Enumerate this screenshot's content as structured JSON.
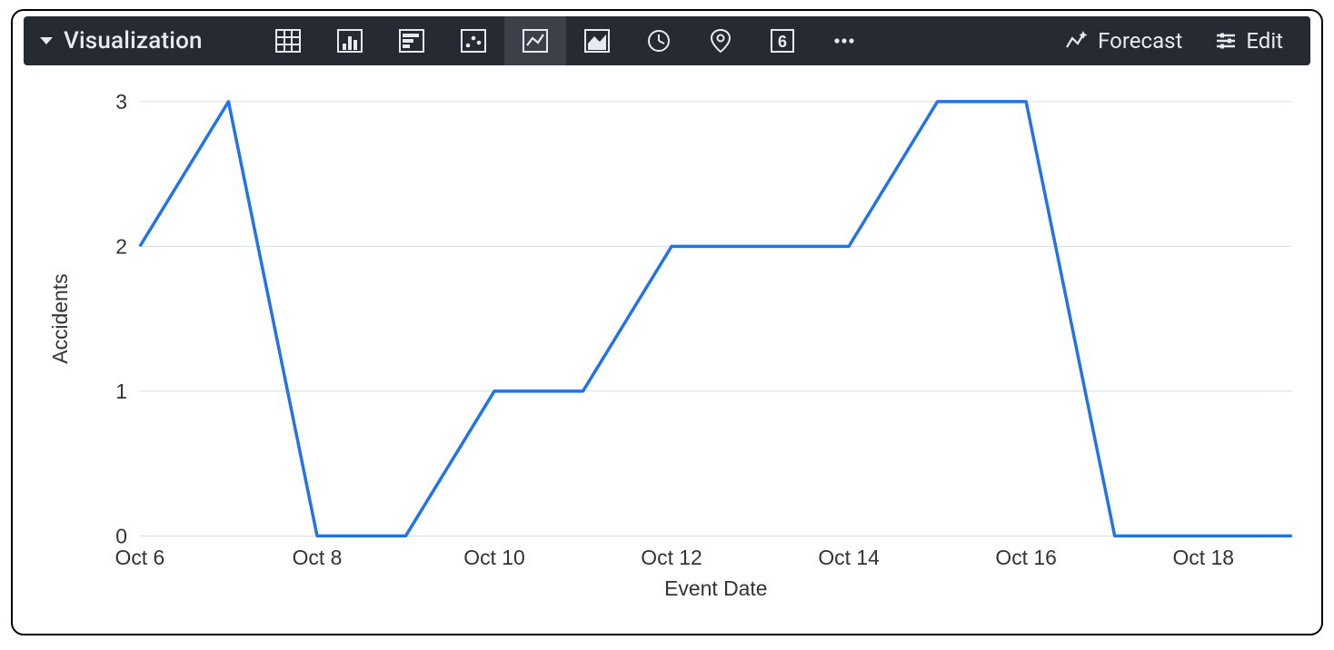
{
  "toolbar": {
    "title": "Visualization",
    "forecast_label": "Forecast",
    "edit_label": "Edit",
    "icons": [
      "table-icon",
      "column-chart-icon",
      "bar-chart-icon",
      "scatter-icon",
      "line-chart-icon",
      "area-chart-icon",
      "timewrap-icon",
      "map-pin-icon",
      "single-value-icon",
      "more-icon"
    ],
    "selected_icon": "line-chart-icon"
  },
  "chart_data": {
    "type": "line",
    "xlabel": "Event Date",
    "ylabel": "Accidents",
    "ylim": [
      0,
      3
    ],
    "y_ticks": [
      0,
      1,
      2,
      3
    ],
    "x_tick_labels": [
      "Oct 6",
      "Oct 8",
      "Oct 10",
      "Oct 12",
      "Oct 14",
      "Oct 16",
      "Oct 18"
    ],
    "x_tick_indices": [
      0,
      2,
      4,
      6,
      8,
      10,
      12
    ],
    "categories": [
      "Oct 6",
      "Oct 7",
      "Oct 8",
      "Oct 9",
      "Oct 10",
      "Oct 11",
      "Oct 12",
      "Oct 13",
      "Oct 14",
      "Oct 15",
      "Oct 16",
      "Oct 17",
      "Oct 18",
      "Oct 19"
    ],
    "series": [
      {
        "name": "Accidents",
        "color": "#2173e8",
        "values": [
          2,
          3,
          0,
          0,
          1,
          1,
          2,
          2,
          2,
          3,
          3,
          0,
          0,
          0
        ]
      }
    ]
  }
}
